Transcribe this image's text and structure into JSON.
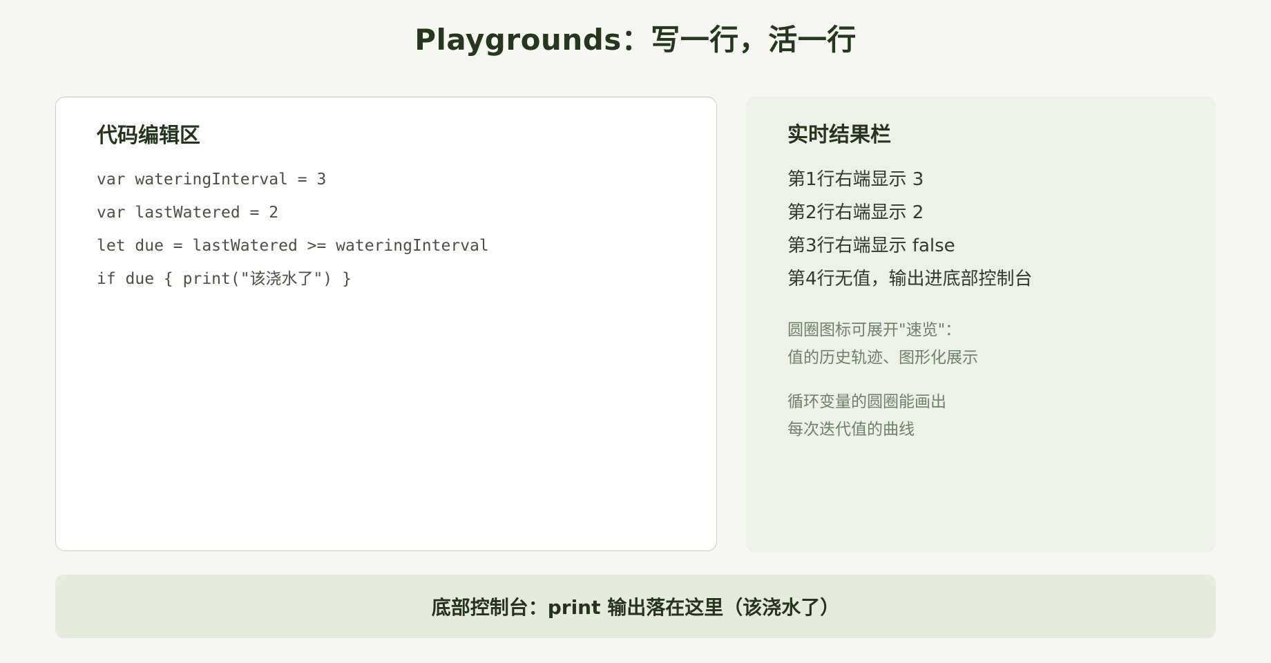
{
  "page": {
    "title": "Playgrounds：写一行，活一行"
  },
  "editor": {
    "title": "代码编辑区",
    "lines": [
      "var wateringInterval = 3",
      "var lastWatered = 2",
      "let due = lastWatered >= wateringInterval",
      "if due { print(\"该浇水了\") }"
    ]
  },
  "results": {
    "title": "实时结果栏",
    "lines": [
      "第1行右端显示 3",
      "第2行右端显示 2",
      "第3行右端显示 false",
      "第4行无值，输出进底部控制台"
    ],
    "notes": [
      [
        "圆圈图标可展开\"速览\"：",
        "值的历史轨迹、图形化展示"
      ],
      [
        "循环变量的圆圈能画出",
        "每次迭代值的曲线"
      ]
    ]
  },
  "console": {
    "text": "底部控制台：print 输出落在这里（该浇水了）"
  }
}
